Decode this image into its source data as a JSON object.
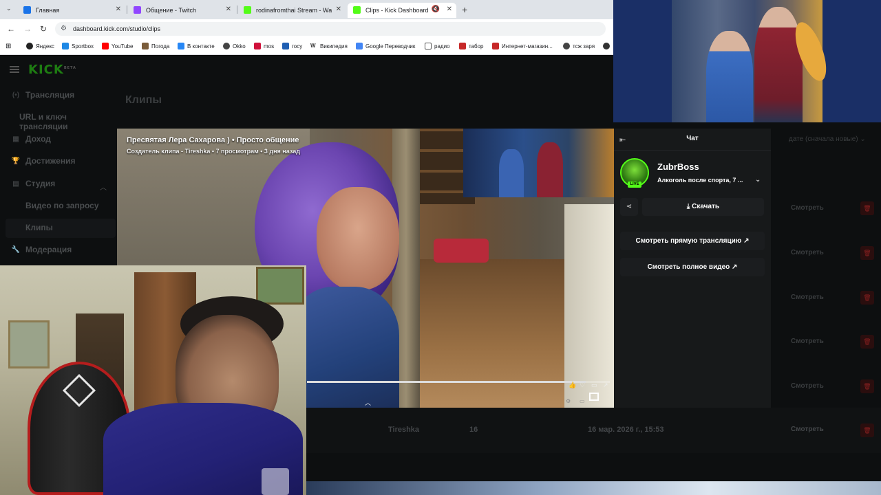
{
  "browser": {
    "tabs": [
      {
        "title": "Главная",
        "color": "#1a73e8"
      },
      {
        "title": "Общение - Twitch",
        "color": "#9146ff"
      },
      {
        "title": "rodinafromthai Stream - Watch",
        "color": "#53fc18"
      },
      {
        "title": "Clips - Kick Dashboard",
        "color": "#53fc18"
      }
    ],
    "new_tab": "+",
    "url": "dashboard.kick.com/studio/clips",
    "bookmarks": [
      {
        "label": "Яндекс",
        "color": "#222"
      },
      {
        "label": "Sportbox",
        "color": "#1e88e5"
      },
      {
        "label": "YouTube",
        "color": "#ff0000"
      },
      {
        "label": "Погода",
        "color": "#7a5c3a"
      },
      {
        "label": "В контакте",
        "color": "#2787f5"
      },
      {
        "label": "Okko",
        "color": "#444"
      },
      {
        "label": "mos",
        "color": "#d0103a"
      },
      {
        "label": "госу",
        "color": "#1f5fb3"
      },
      {
        "label": "Википедия",
        "color": "#555"
      },
      {
        "label": "Google Переводчик",
        "color": "#4285f4"
      },
      {
        "label": "радио",
        "color": "#777"
      },
      {
        "label": "табор",
        "color": "#c62828"
      },
      {
        "label": "Интернет-магазин...",
        "color": "#c62828"
      },
      {
        "label": "тсж заря",
        "color": "#444"
      }
    ]
  },
  "kick": {
    "logo": "KICK",
    "logo_beta": "BETA",
    "sidebar": {
      "items": [
        {
          "label": "Трансляция",
          "icon": "(•)"
        },
        {
          "label": "URL и ключ трансляции",
          "icon": ""
        },
        {
          "label": "Доход",
          "icon": "▦"
        },
        {
          "label": "Достижения",
          "icon": "🏆"
        },
        {
          "label": "Студия",
          "icon": "▤"
        },
        {
          "label": "Модерация",
          "icon": "🔧"
        }
      ],
      "studio_sub": [
        "Видео по запросу",
        "Клипы"
      ]
    },
    "page_title": "Клипы",
    "sort_label": "дате (сначала новые)",
    "row_watch": "Смотреть",
    "bottom_row": {
      "creator": "Tireshka",
      "views": "16",
      "date": "16 мар. 2026 г., 15:53",
      "watch": "Смотреть"
    }
  },
  "clip": {
    "title": "Пресвятая Лера Сахарова ) • Просто общение",
    "subtitle": "Создатель клипа - Tireshka • 7 просмотрам • 3 дня назад",
    "progress": 0.92
  },
  "chat": {
    "title": "Чат",
    "streamer": "ZubrBoss",
    "live": "LIVE",
    "stream_title": "Алкоголь после спорта, 7 ...",
    "download": "Скачать",
    "watch_live": "Смотреть прямую трансляцию",
    "watch_full": "Смотреть полное видео"
  }
}
